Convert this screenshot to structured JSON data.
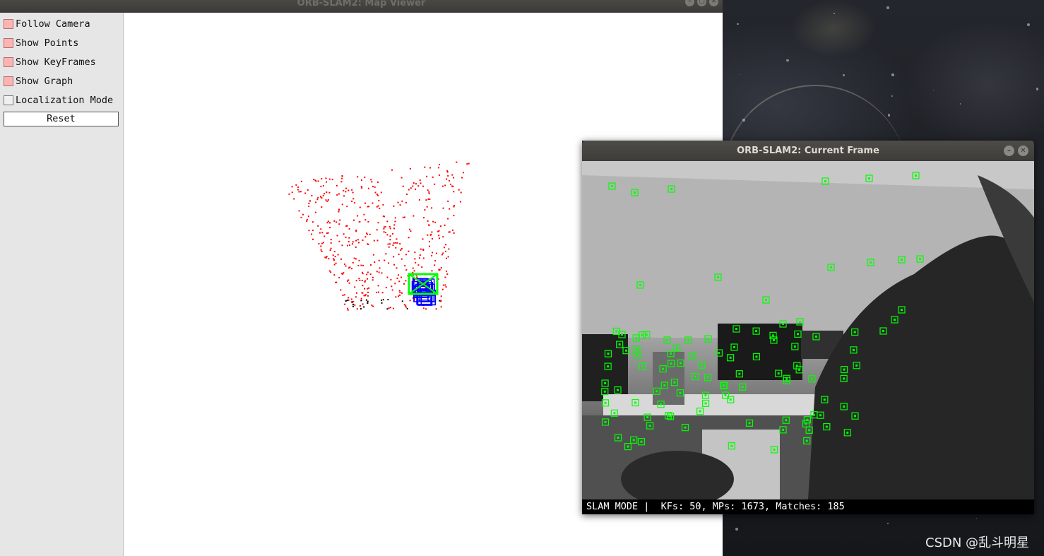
{
  "map_viewer": {
    "title": "ORB-SLAM2: Map Viewer",
    "window_buttons": [
      "–",
      "▢",
      "✕"
    ],
    "panel": {
      "options": [
        {
          "label": "Follow Camera",
          "checked": true
        },
        {
          "label": "Show Points",
          "checked": true
        },
        {
          "label": "Show KeyFrames",
          "checked": true
        },
        {
          "label": "Show Graph",
          "checked": true
        },
        {
          "label": "Localization Mode",
          "checked": false
        }
      ],
      "reset_label": "Reset"
    },
    "colors": {
      "map_points": "#ff0000",
      "reference_points": "#000000",
      "keyframes": "#0000ff",
      "current_camera": "#00ff00"
    }
  },
  "current_frame": {
    "title": "ORB-SLAM2: Current Frame",
    "window_buttons": [
      "–",
      "✕"
    ],
    "status_text": "SLAM MODE |  KFs: 50, MPs: 1673, Matches: 185",
    "colors": {
      "feature_boxes": "#00ff00"
    }
  },
  "watermark": "CSDN @乱斗明星"
}
